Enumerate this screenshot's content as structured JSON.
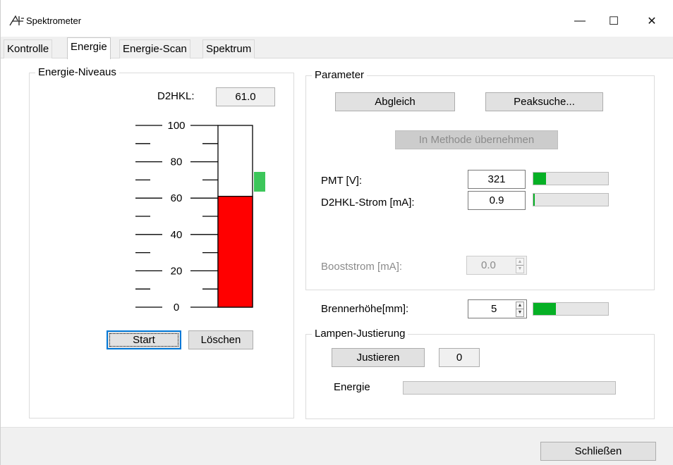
{
  "window": {
    "title": "Spektrometer",
    "min_glyph": "—",
    "max_glyph": "☐",
    "close_glyph": "✕"
  },
  "tabs": [
    {
      "label": "Kontrolle",
      "active": false
    },
    {
      "label": "Energie",
      "active": true
    },
    {
      "label": "Energie-Scan",
      "active": false
    },
    {
      "label": "Spektrum",
      "active": false
    }
  ],
  "energy_levels": {
    "group_title": "Energie-Niveaus",
    "d2hkl_label": "D2HKL:",
    "d2hkl_value": "61.0",
    "scale_ticks": [
      "100",
      "80",
      "60",
      "40",
      "20",
      "0"
    ],
    "scale_max": 100,
    "bar_value": 61.0,
    "bar_color": "#ff0000",
    "marker_value": 69,
    "marker_color": "#3cc65a",
    "start_label": "Start",
    "clear_label": "Löschen"
  },
  "parameters": {
    "group_title": "Parameter",
    "adjust_label": "Abgleich",
    "peak_search_label": "Peaksuche...",
    "adopt_method_label": "In Methode übernehmen",
    "pmt_label": "PMT [V]:",
    "pmt_value": "321",
    "pmt_level": 0.17,
    "d2hkl_current_label": "D2HKL-Strom [mA]:",
    "d2hkl_current_value": "0.9",
    "d2hkl_current_level": 0.02,
    "boost_label": "Booststrom [mA]:",
    "boost_value": "0.0"
  },
  "burner": {
    "label": "Brennerhöhe[mm]:",
    "value": "5",
    "level": 0.3
  },
  "lamp_alignment": {
    "group_title": "Lampen-Justierung",
    "adjust_label": "Justieren",
    "adjust_value": "0",
    "energy_label": "Energie",
    "energy_level": 0
  },
  "footer": {
    "close_label": "Schließen"
  },
  "colors": {
    "progress_fill": "#06b025",
    "focus_blue": "#0078d7"
  }
}
